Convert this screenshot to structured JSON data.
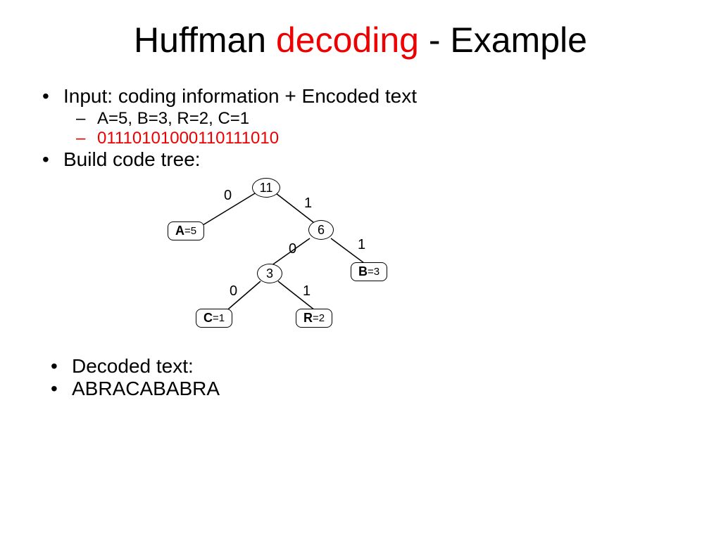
{
  "title": {
    "part1": "Huffman ",
    "part2": "decoding",
    "part3": " - Example"
  },
  "bullets": {
    "input_label": "Input: coding information + Encoded text",
    "freq_line": "A=5, B=3, R=2, C=1",
    "encoded_bits": "01110101000110111010",
    "build_tree": "Build code tree:",
    "decoded_label": "Decoded text:",
    "decoded_value": "ABRACABABRA"
  },
  "tree": {
    "root": "11",
    "n6": "6",
    "n3": "3",
    "leaf_a": {
      "letter": "A",
      "val": "=5"
    },
    "leaf_b": {
      "letter": "B",
      "val": "=3"
    },
    "leaf_c": {
      "letter": "C",
      "val": "=1"
    },
    "leaf_r": {
      "letter": "R",
      "val": "=2"
    },
    "edges": {
      "root_left": "0",
      "root_right": "1",
      "n6_left": "0",
      "n6_right": "1",
      "n3_left": "0",
      "n3_right": "1"
    }
  }
}
